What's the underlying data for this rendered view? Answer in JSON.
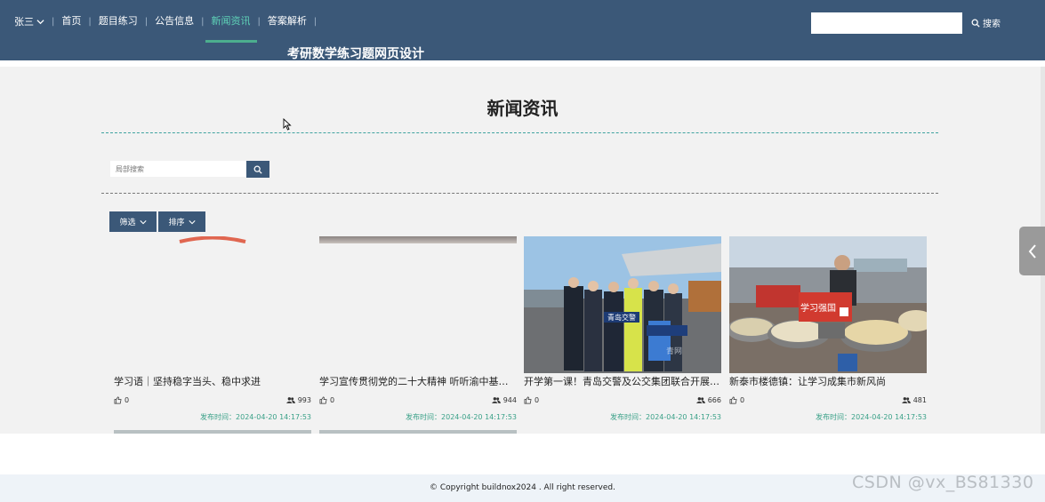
{
  "header": {
    "user": "张三",
    "nav": [
      "首页",
      "题目练习",
      "公告信息",
      "新闻资讯",
      "答案解析"
    ],
    "active_nav": "新闻资讯",
    "search_placeholder": "",
    "search_label": "搜索",
    "site_title": "考研数学练习题网页设计"
  },
  "main": {
    "page_title": "新闻资讯",
    "local_search_placeholder": "局部搜索",
    "filter_label": "筛选",
    "sort_label": "排序"
  },
  "cards": [
    {
      "title": "学习语｜坚持稳字当头、稳中求进",
      "likes": "0",
      "views": "993",
      "date_label": "发布时间：2024-04-20 14:17:53",
      "image": "blank-image-with-red-arc"
    },
    {
      "title": "学习宣传贯彻党的二十大精神 听听渝中基层干部怎么说",
      "likes": "0",
      "views": "944",
      "date_label": "发布时间：2024-04-20 14:17:53",
      "image": "blank-image-with-gray-top"
    },
    {
      "title": "开学第一课！青岛交警及公交集团联合开展交通安全进校园活动",
      "likes": "0",
      "views": "666",
      "date_label": "发布时间：2024-04-20 14:17:53",
      "image": "police-and-children-photo",
      "sign_text": "青岛交警",
      "photo_watermark": "青网"
    },
    {
      "title": "新泰市楼德镇：让学习成集市新风尚",
      "likes": "0",
      "views": "481",
      "date_label": "发布时间：2024-04-20 14:17:53",
      "image": "market-stall-photo",
      "sign_text": "学习强国"
    }
  ],
  "footer": {
    "copyright": "© Copyright buildnox2024 . All right reserved.",
    "watermark": "CSDN @vx_BS81330"
  },
  "colors": {
    "header_bg": "#3b5878",
    "accent": "#4cae8e",
    "date_text": "#3aa188"
  }
}
